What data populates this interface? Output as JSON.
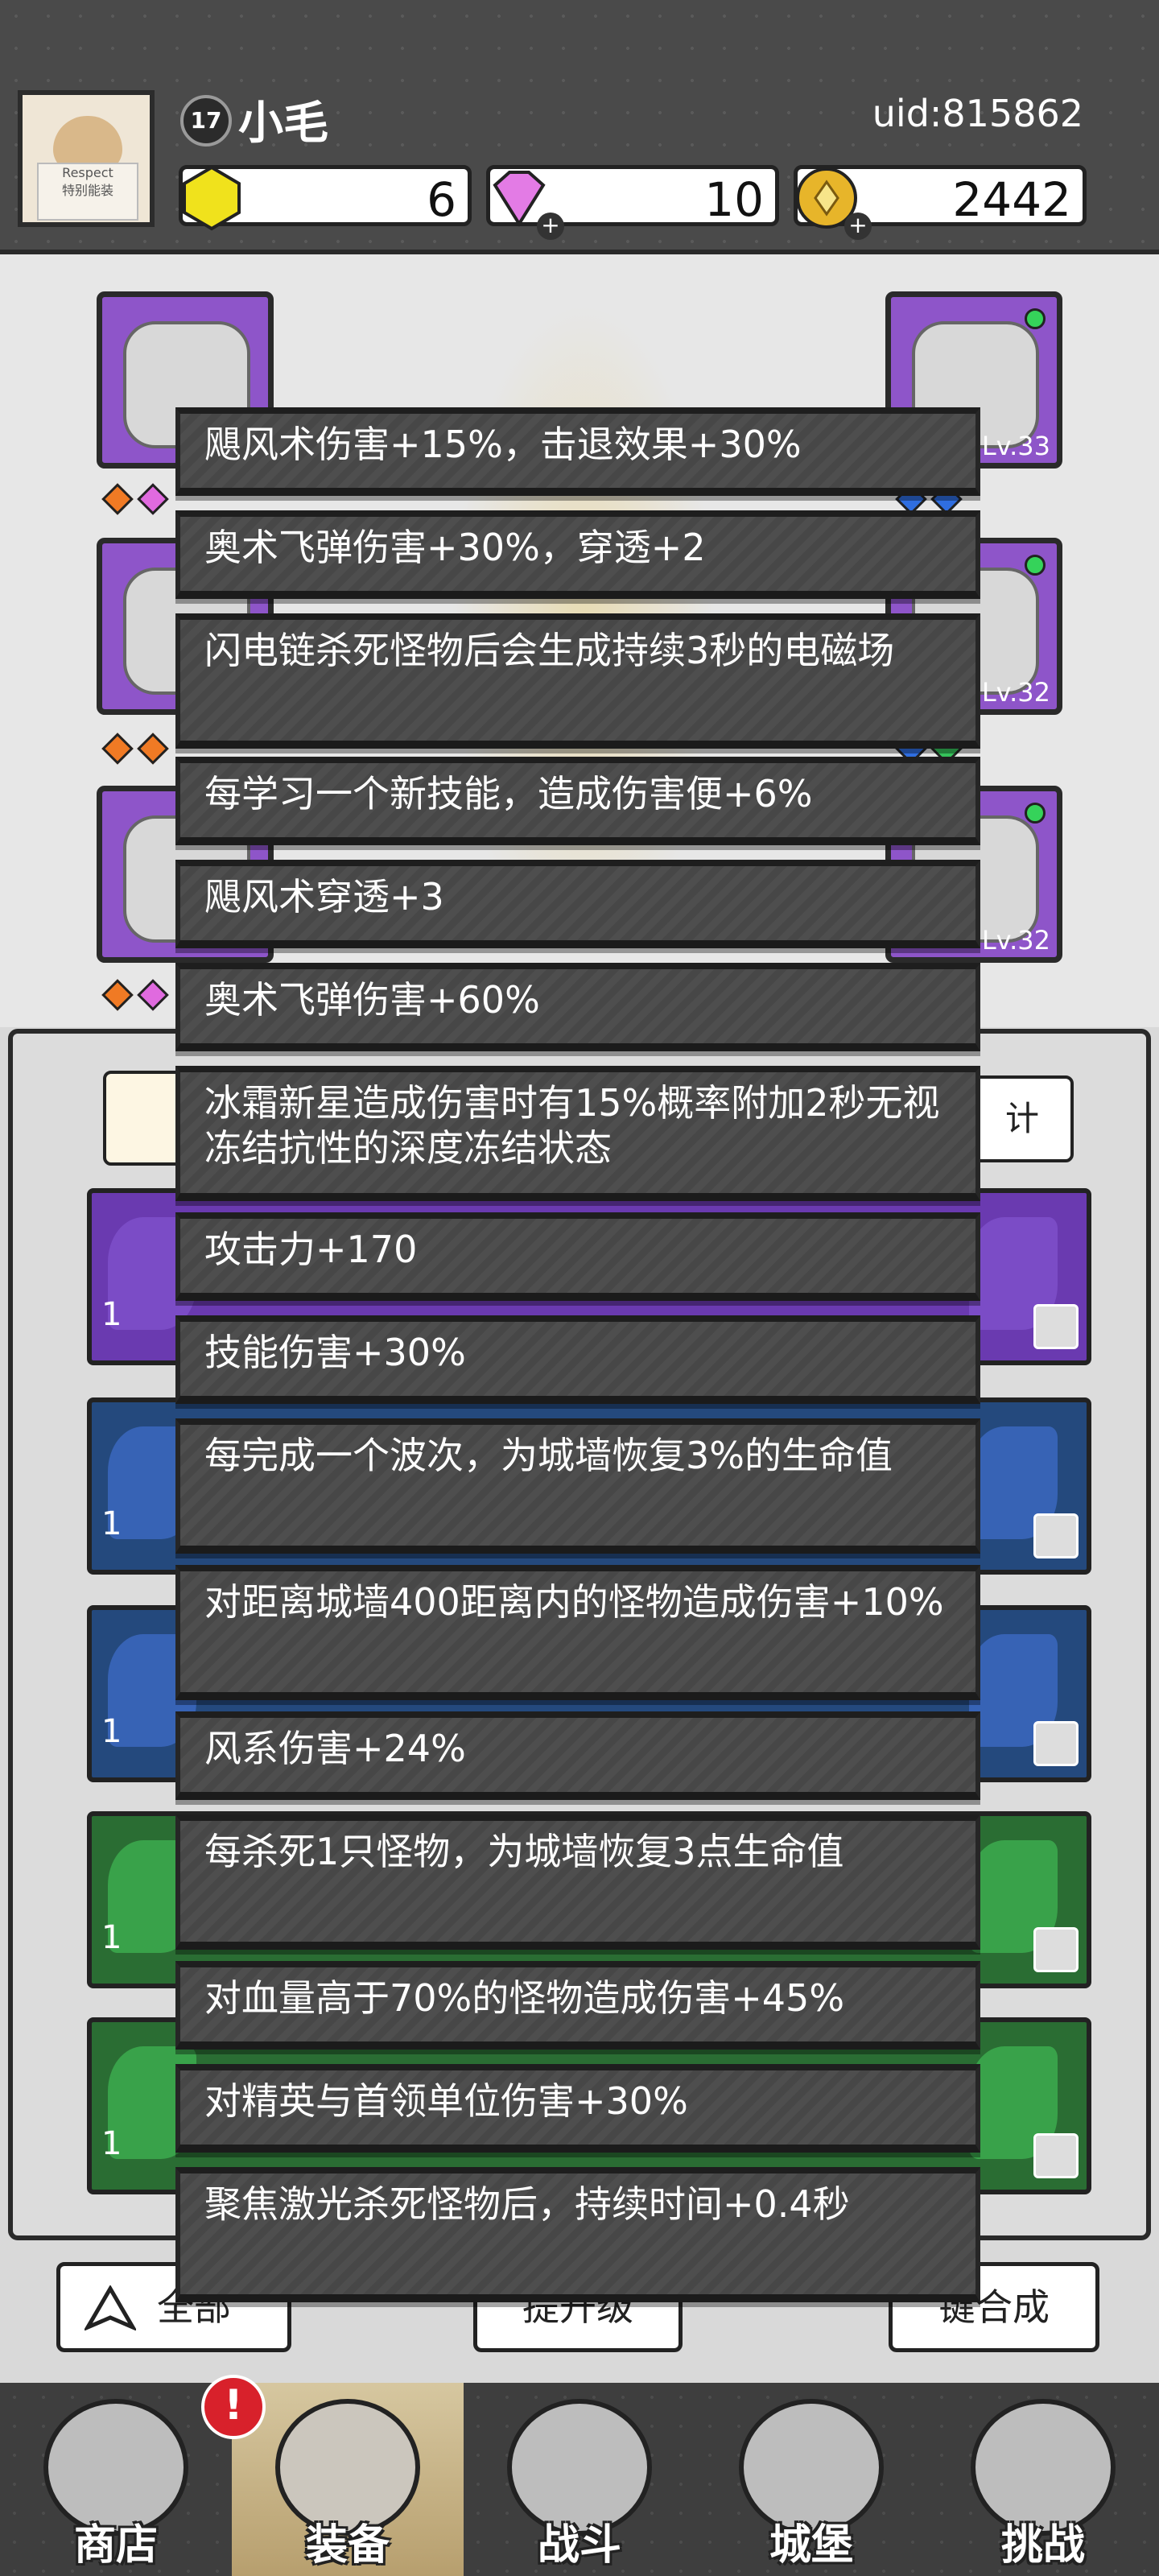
{
  "profile": {
    "level": "17",
    "name": "小毛",
    "uid": "uid:815862",
    "avatar_text_1": "Respect",
    "avatar_text_2": "特别能装"
  },
  "resources": {
    "gold_crystal": "6",
    "diamond": "10",
    "coin": "2442"
  },
  "equipment_slots": {
    "right_top_lv": "Lv.33",
    "right_mid_lv": "Lv.32",
    "right_bot_lv": "Lv.32"
  },
  "panel": {
    "stats_button": "计"
  },
  "inventory_counts": [
    "1",
    "1",
    "1",
    "1",
    "1"
  ],
  "filters": {
    "all_label": "全部",
    "upgrade_label": "提升级",
    "synth_label": "键合成"
  },
  "nav": {
    "shop": "商店",
    "equip": "装备",
    "battle": "战斗",
    "castle": "城堡",
    "challenge": "挑战",
    "badge": "!"
  },
  "skill_entries": [
    "飓风术伤害+15%，击退效果+30%",
    "奥术飞弹伤害+30%，穿透+2",
    "闪电链杀死怪物后会生成持续3秒的电磁场",
    "每学习一个新技能，造成伤害便+6%",
    "飓风术穿透+3",
    "奥术飞弹伤害+60%",
    "冰霜新星造成伤害时有15%概率附加2秒无视冻结抗性的深度冻结状态",
    "攻击力+170",
    "技能伤害+30%",
    "每完成一个波次，为城墙恢复3%的生命值",
    "对距离城墙400距离内的怪物造成伤害+10%",
    "风系伤害+24%",
    "每杀死1只怪物，为城墙恢复3点生命值",
    "对血量高于70%的怪物造成伤害+45%",
    "对精英与首领单位伤害+30%",
    "聚焦激光杀死怪物后，持续时间+0.4秒"
  ],
  "icons": [
    "crystal-icon",
    "diamond-icon",
    "coin-icon",
    "plus-icon",
    "shirt-icon",
    "shop-icon",
    "equip-bag-icon",
    "swords-icon",
    "castle-icon",
    "shield-icon"
  ],
  "colors": {
    "purple": "#8e55c9",
    "blue": "#2c5a9a",
    "green": "#2f8a3a",
    "badge_red": "#d8212b"
  }
}
